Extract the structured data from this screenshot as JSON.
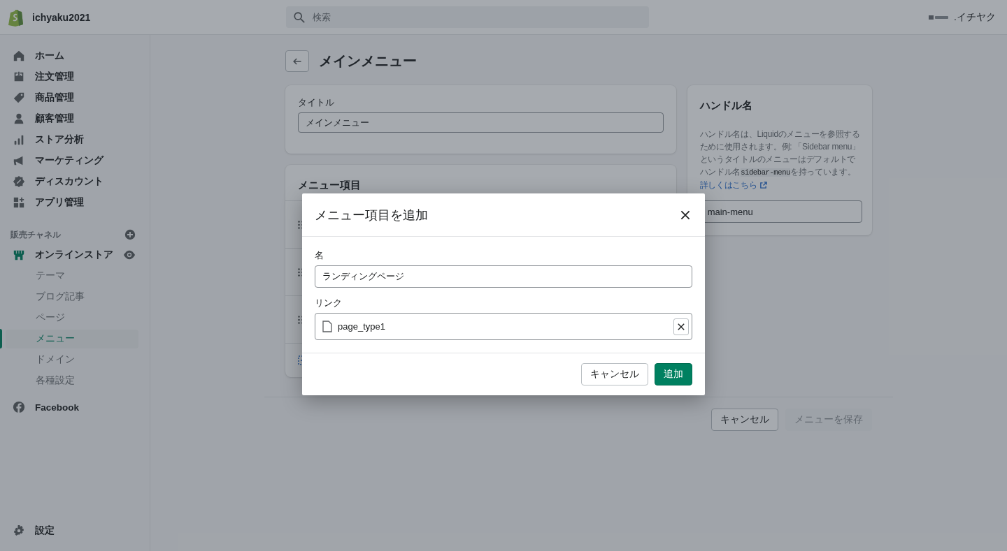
{
  "topbar": {
    "store_name": "ichyaku2021",
    "search": {
      "placeholder": "検索"
    },
    "account_name": ".イチヤク"
  },
  "sidebar": {
    "items": [
      {
        "label": "ホーム",
        "selected": false
      },
      {
        "label": "注文管理",
        "selected": false
      },
      {
        "label": "商品管理",
        "selected": false
      },
      {
        "label": "顧客管理",
        "selected": false
      },
      {
        "label": "ストア分析",
        "selected": false
      },
      {
        "label": "マーケティング",
        "selected": false
      },
      {
        "label": "ディスカウント",
        "selected": false
      },
      {
        "label": "アプリ管理",
        "selected": false
      }
    ],
    "sales_channels": {
      "heading": "販売チャネル",
      "online_store": {
        "label": "オンラインストア",
        "children": [
          {
            "label": "テーマ",
            "selected": false
          },
          {
            "label": "ブログ記事",
            "selected": false
          },
          {
            "label": "ページ",
            "selected": false
          },
          {
            "label": "メニュー",
            "selected": true
          },
          {
            "label": "ドメイン",
            "selected": false
          },
          {
            "label": "各種設定",
            "selected": false
          }
        ]
      },
      "facebook": {
        "label": "Facebook"
      }
    },
    "settings": {
      "label": "設定"
    }
  },
  "page": {
    "title": "メインメニュー",
    "title_card": {
      "label": "タイトル",
      "value": "メインメニュー"
    },
    "menu_items_card": {
      "heading": "メニュー項目"
    },
    "handle_card": {
      "heading": "ハンドル名",
      "text_before": "ハンドル名は、Liquidのメニューを参照するために使用されます。例: 「Sidebar menu」というタイトルのメニューはデフォルトでハンドル名",
      "code": "sidebar-menu",
      "text_after": "を持っています。",
      "link": "詳しくはこちら",
      "value": "main-menu"
    },
    "actions": [
      {
        "label": "キャンセル",
        "disabled": false
      },
      {
        "label": "メニューを保存",
        "disabled": true
      }
    ]
  },
  "modal": {
    "title": "メニュー項目を追加",
    "name_field": {
      "label": "名",
      "value": "ランディングページ"
    },
    "link_field": {
      "label": "リンク",
      "value": "page_type1"
    },
    "buttons": [
      {
        "label": "キャンセル",
        "kind": "secondary"
      },
      {
        "label": "追加",
        "kind": "primary"
      }
    ]
  }
}
